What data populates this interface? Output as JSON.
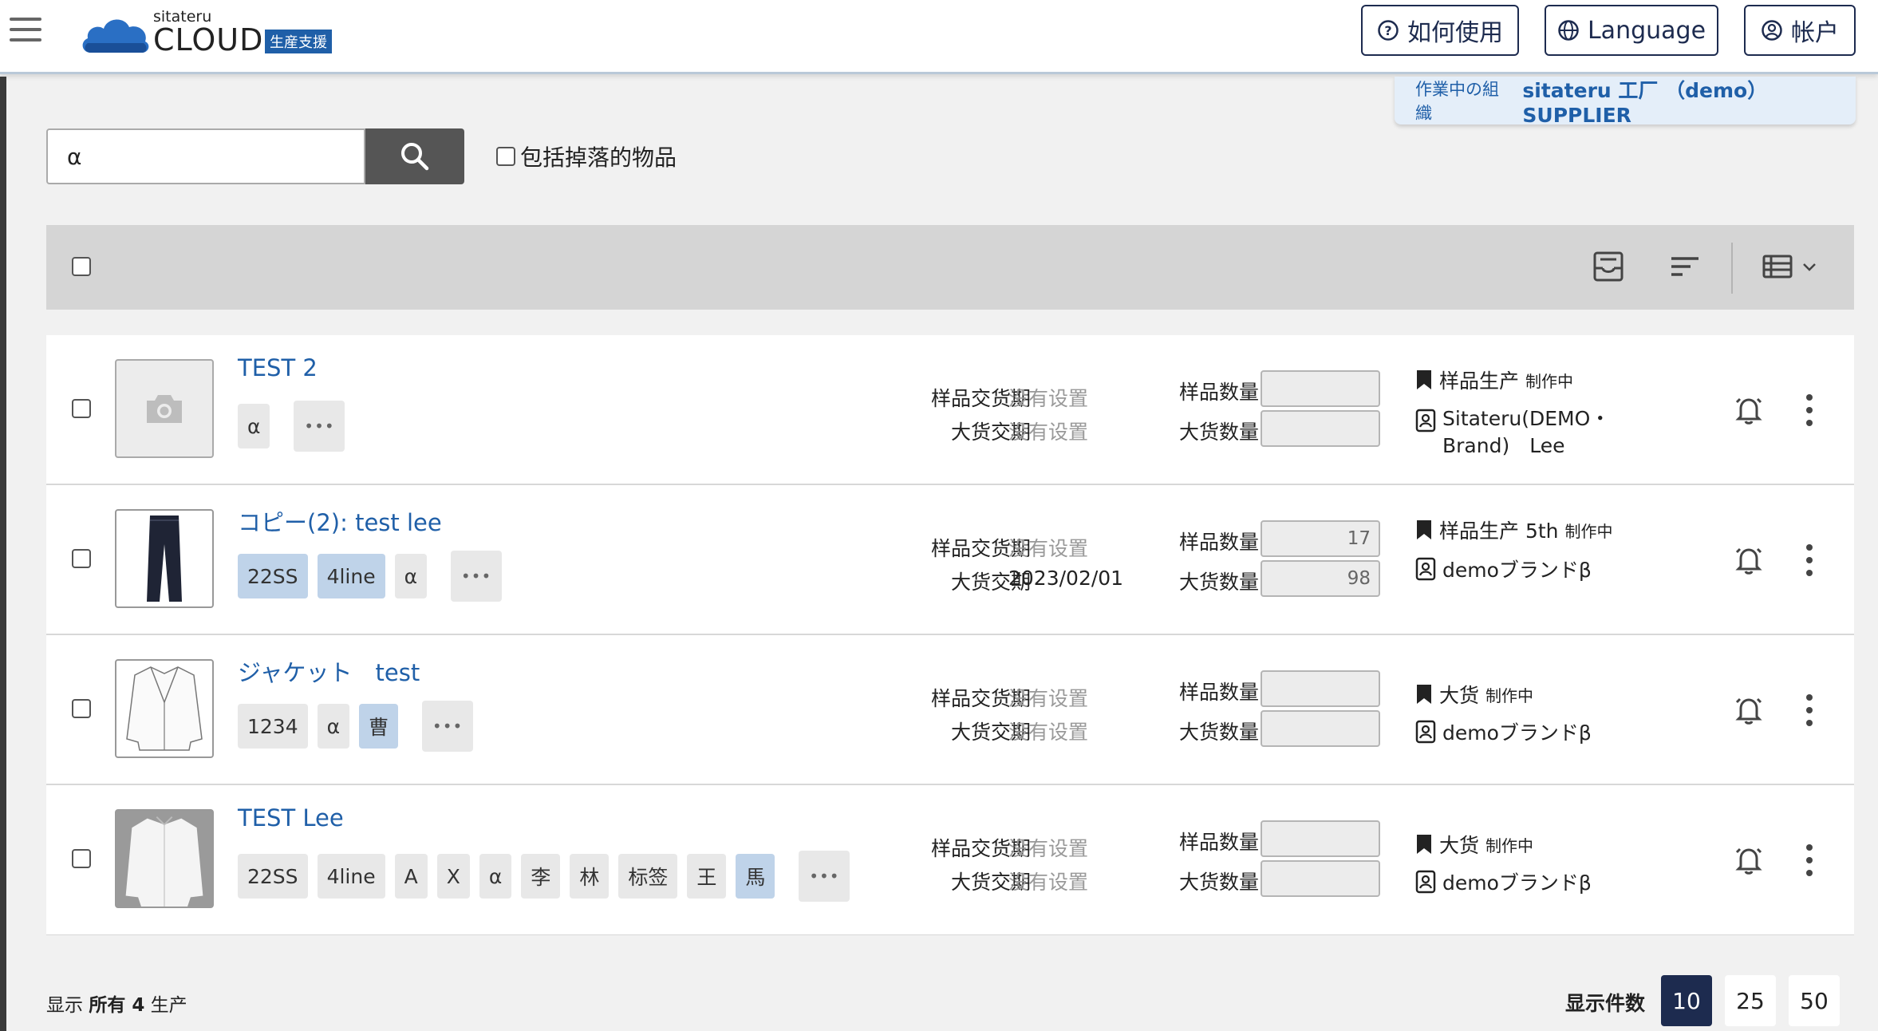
{
  "header": {
    "logo_small": "sitateru",
    "logo_big": "CLOUD",
    "logo_badge": "生産支援",
    "help_label": "如何使用",
    "language_label": "Language",
    "account_label": "帐户"
  },
  "org": {
    "label": "作業中の組織",
    "name": "sitateru 工厂 （demo） SUPPLIER"
  },
  "search": {
    "value": "α",
    "include_dropped_label": "包括掉落的物品"
  },
  "labels": {
    "sample_delivery": "样品交货期",
    "bulk_delivery": "大货交期",
    "sample_qty": "样品数量",
    "bulk_qty": "大货数量"
  },
  "items": [
    {
      "title": "TEST 2",
      "tags": [
        "α"
      ],
      "sample_delivery": "没有设置",
      "bulk_delivery": "没有设置",
      "sample_qty": "",
      "bulk_qty": "",
      "stage": "样品生产",
      "stage_status": "制作中",
      "brand": "Sitateru(DEMO・Brand)　Lee"
    },
    {
      "title": "コピー(2): test lee",
      "tags": [
        "22SS",
        "4line",
        "α"
      ],
      "sample_delivery": "没有设置",
      "bulk_delivery": "2023/02/01",
      "sample_qty": "17",
      "bulk_qty": "98",
      "stage": "样品生产 5th",
      "stage_status": "制作中",
      "brand": "demoブランドβ"
    },
    {
      "title": "ジャケット　test",
      "tags": [
        "1234",
        "α",
        "曹"
      ],
      "sample_delivery": "没有设置",
      "bulk_delivery": "没有设置",
      "sample_qty": "",
      "bulk_qty": "",
      "stage": "大货",
      "stage_status": "制作中",
      "brand": "demoブランドβ"
    },
    {
      "title": "TEST Lee",
      "tags": [
        "22SS",
        "4line",
        "A",
        "X",
        "α",
        "李",
        "林",
        "标签",
        "王",
        "馬"
      ],
      "sample_delivery": "没有设置",
      "bulk_delivery": "没有设置",
      "sample_qty": "",
      "bulk_qty": "",
      "stage": "大货",
      "stage_status": "制作中",
      "brand": "demoブランドβ"
    }
  ],
  "footer": {
    "count_prefix": "显示",
    "count_bold": "所有 4",
    "count_suffix": "生产",
    "per_page_label": "显示件数",
    "per_page_options": [
      "10",
      "25",
      "50"
    ],
    "per_page_selected": "10"
  },
  "colors": {
    "accent": "#1f5fa8",
    "navy": "#1d2b4f",
    "tag_blue": "#bfd3e9",
    "toolbar_bg": "#d5d5d5"
  },
  "icons": {
    "help": "question-circle-icon",
    "language": "globe-icon",
    "account": "user-circle-icon",
    "search": "search-icon",
    "stage": "bookmark-icon",
    "brand": "brand-card-icon",
    "notify": "bell-icon",
    "menu": "more-vertical-icon"
  }
}
